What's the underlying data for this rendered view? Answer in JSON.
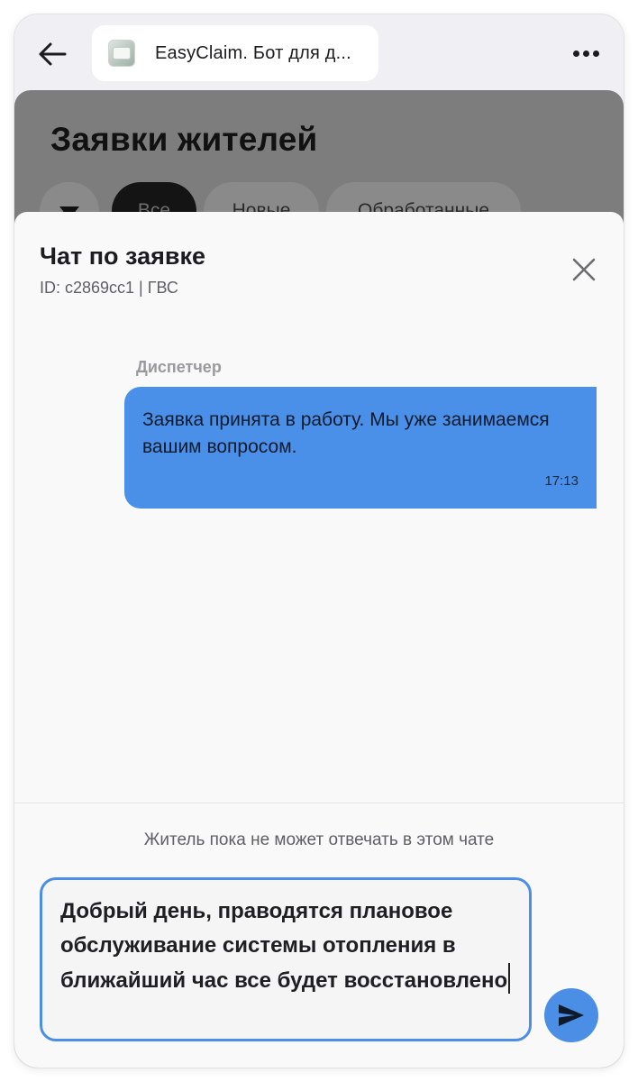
{
  "topbar": {
    "app_title": "EasyClaim. Бот для д...",
    "back_icon": "arrow-left-icon",
    "more_icon": "more-horizontal-icon"
  },
  "background_page": {
    "title": "Заявки жителей",
    "filters": [
      "Все",
      "Новые",
      "Обработанные"
    ]
  },
  "chat": {
    "title": "Чат по заявке",
    "subtitle": "ID: c2869cc1 | ГВС",
    "messages": [
      {
        "sender": "Диспетчер",
        "text": "Заявка принята в работу. Мы уже занимаемся вашим вопросом.",
        "time": "17:13"
      }
    ],
    "notice": "Житель пока не может отвечать в этом чате",
    "input": {
      "value": "Добрый день, праводятся плановое обслуживание системы отопления в ближайший час все будет восстановлено"
    }
  },
  "colors": {
    "accent": "#4a8ee6",
    "bubble": "#4a90e8",
    "overlay": "#7d7d7d"
  }
}
